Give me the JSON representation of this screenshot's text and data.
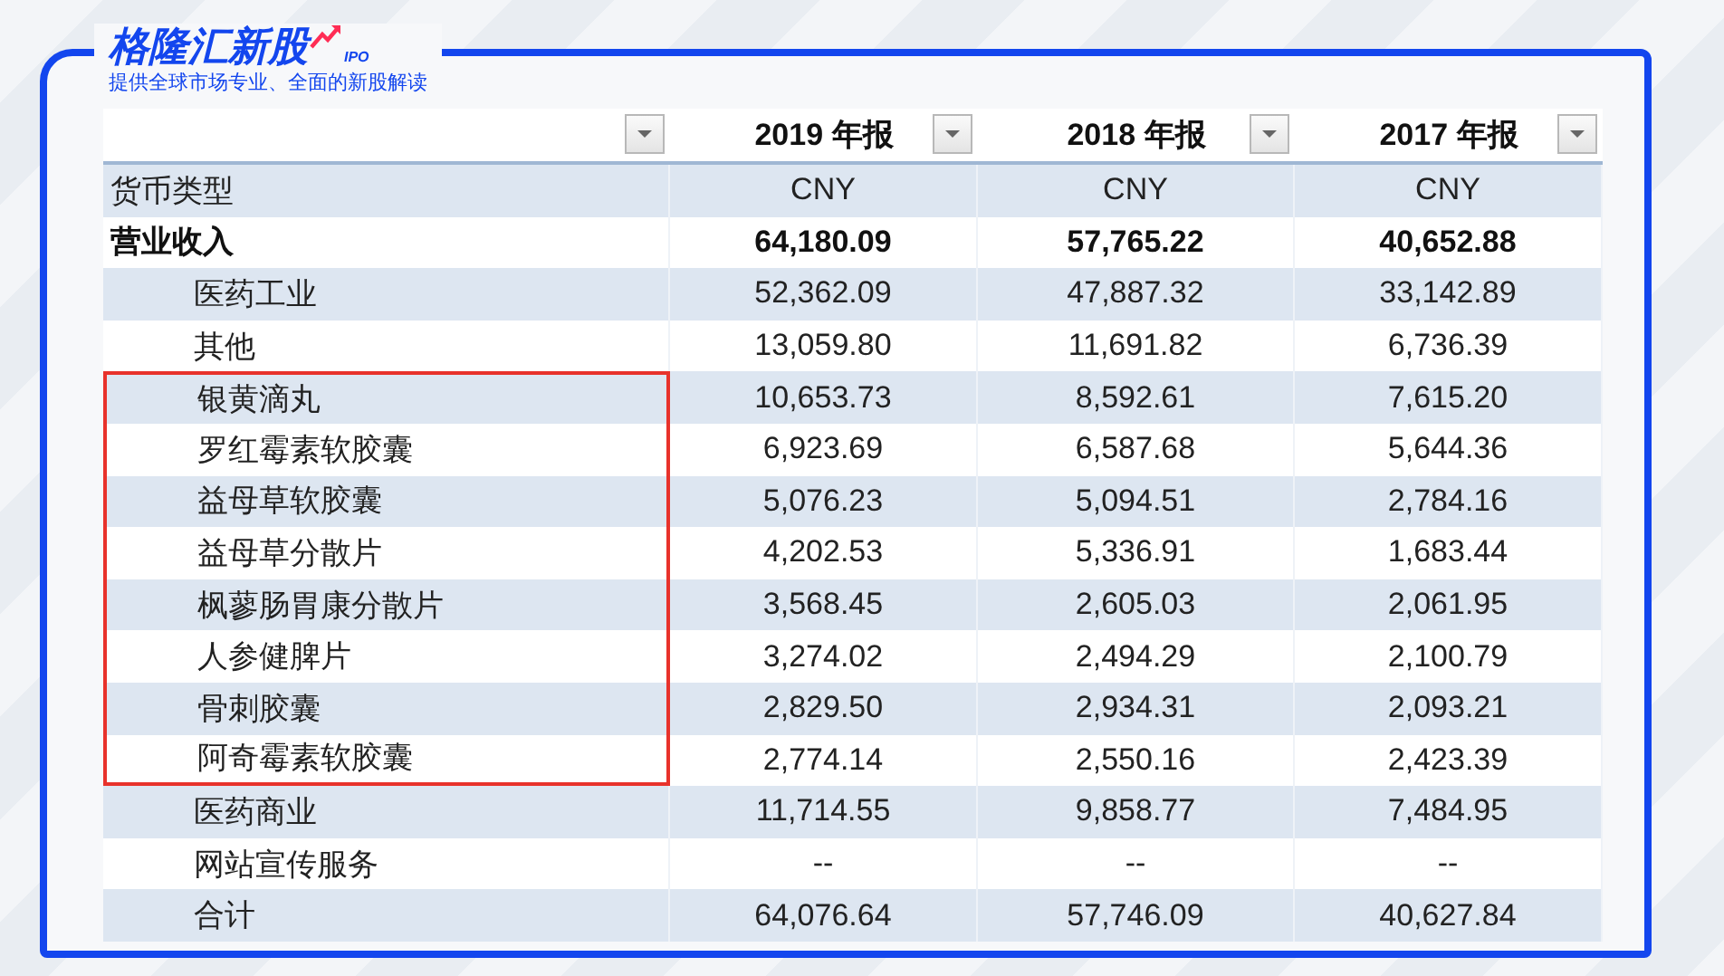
{
  "logo": {
    "title": "格隆汇新股",
    "badge": "IPO",
    "tagline": "提供全球市场专业、全面的新股解读"
  },
  "table": {
    "columns": [
      {
        "label": "2019 年报"
      },
      {
        "label": "2018 年报"
      },
      {
        "label": "2017 年报"
      }
    ],
    "rows": [
      {
        "kind": "currency",
        "label": "货币类型",
        "values": [
          "CNY",
          "CNY",
          "CNY"
        ],
        "highlighted": false
      },
      {
        "kind": "group",
        "label": "营业收入",
        "values": [
          "64,180.09",
          "57,765.22",
          "40,652.88"
        ],
        "highlighted": false
      },
      {
        "kind": "item",
        "label": "医药工业",
        "values": [
          "52,362.09",
          "47,887.32",
          "33,142.89"
        ],
        "highlighted": false
      },
      {
        "kind": "item",
        "label": "其他",
        "values": [
          "13,059.80",
          "11,691.82",
          "6,736.39"
        ],
        "highlighted": false
      },
      {
        "kind": "item",
        "label": "银黄滴丸",
        "values": [
          "10,653.73",
          "8,592.61",
          "7,615.20"
        ],
        "highlighted": true
      },
      {
        "kind": "item",
        "label": "罗红霉素软胶囊",
        "values": [
          "6,923.69",
          "6,587.68",
          "5,644.36"
        ],
        "highlighted": true
      },
      {
        "kind": "item",
        "label": "益母草软胶囊",
        "values": [
          "5,076.23",
          "5,094.51",
          "2,784.16"
        ],
        "highlighted": true
      },
      {
        "kind": "item",
        "label": "益母草分散片",
        "values": [
          "4,202.53",
          "5,336.91",
          "1,683.44"
        ],
        "highlighted": true
      },
      {
        "kind": "item",
        "label": "枫蓼肠胃康分散片",
        "values": [
          "3,568.45",
          "2,605.03",
          "2,061.95"
        ],
        "highlighted": true
      },
      {
        "kind": "item",
        "label": "人参健脾片",
        "values": [
          "3,274.02",
          "2,494.29",
          "2,100.79"
        ],
        "highlighted": true
      },
      {
        "kind": "item",
        "label": "骨刺胶囊",
        "values": [
          "2,829.50",
          "2,934.31",
          "2,093.21"
        ],
        "highlighted": true
      },
      {
        "kind": "item",
        "label": "阿奇霉素软胶囊",
        "values": [
          "2,774.14",
          "2,550.16",
          "2,423.39"
        ],
        "highlighted": true
      },
      {
        "kind": "item",
        "label": "医药商业",
        "values": [
          "11,714.55",
          "9,858.77",
          "7,484.95"
        ],
        "highlighted": false
      },
      {
        "kind": "item",
        "label": "网站宣传服务",
        "values": [
          "--",
          "--",
          "--"
        ],
        "highlighted": false
      },
      {
        "kind": "item",
        "label": "合计",
        "values": [
          "64,076.64",
          "57,746.09",
          "40,627.84"
        ],
        "highlighted": false
      }
    ]
  }
}
